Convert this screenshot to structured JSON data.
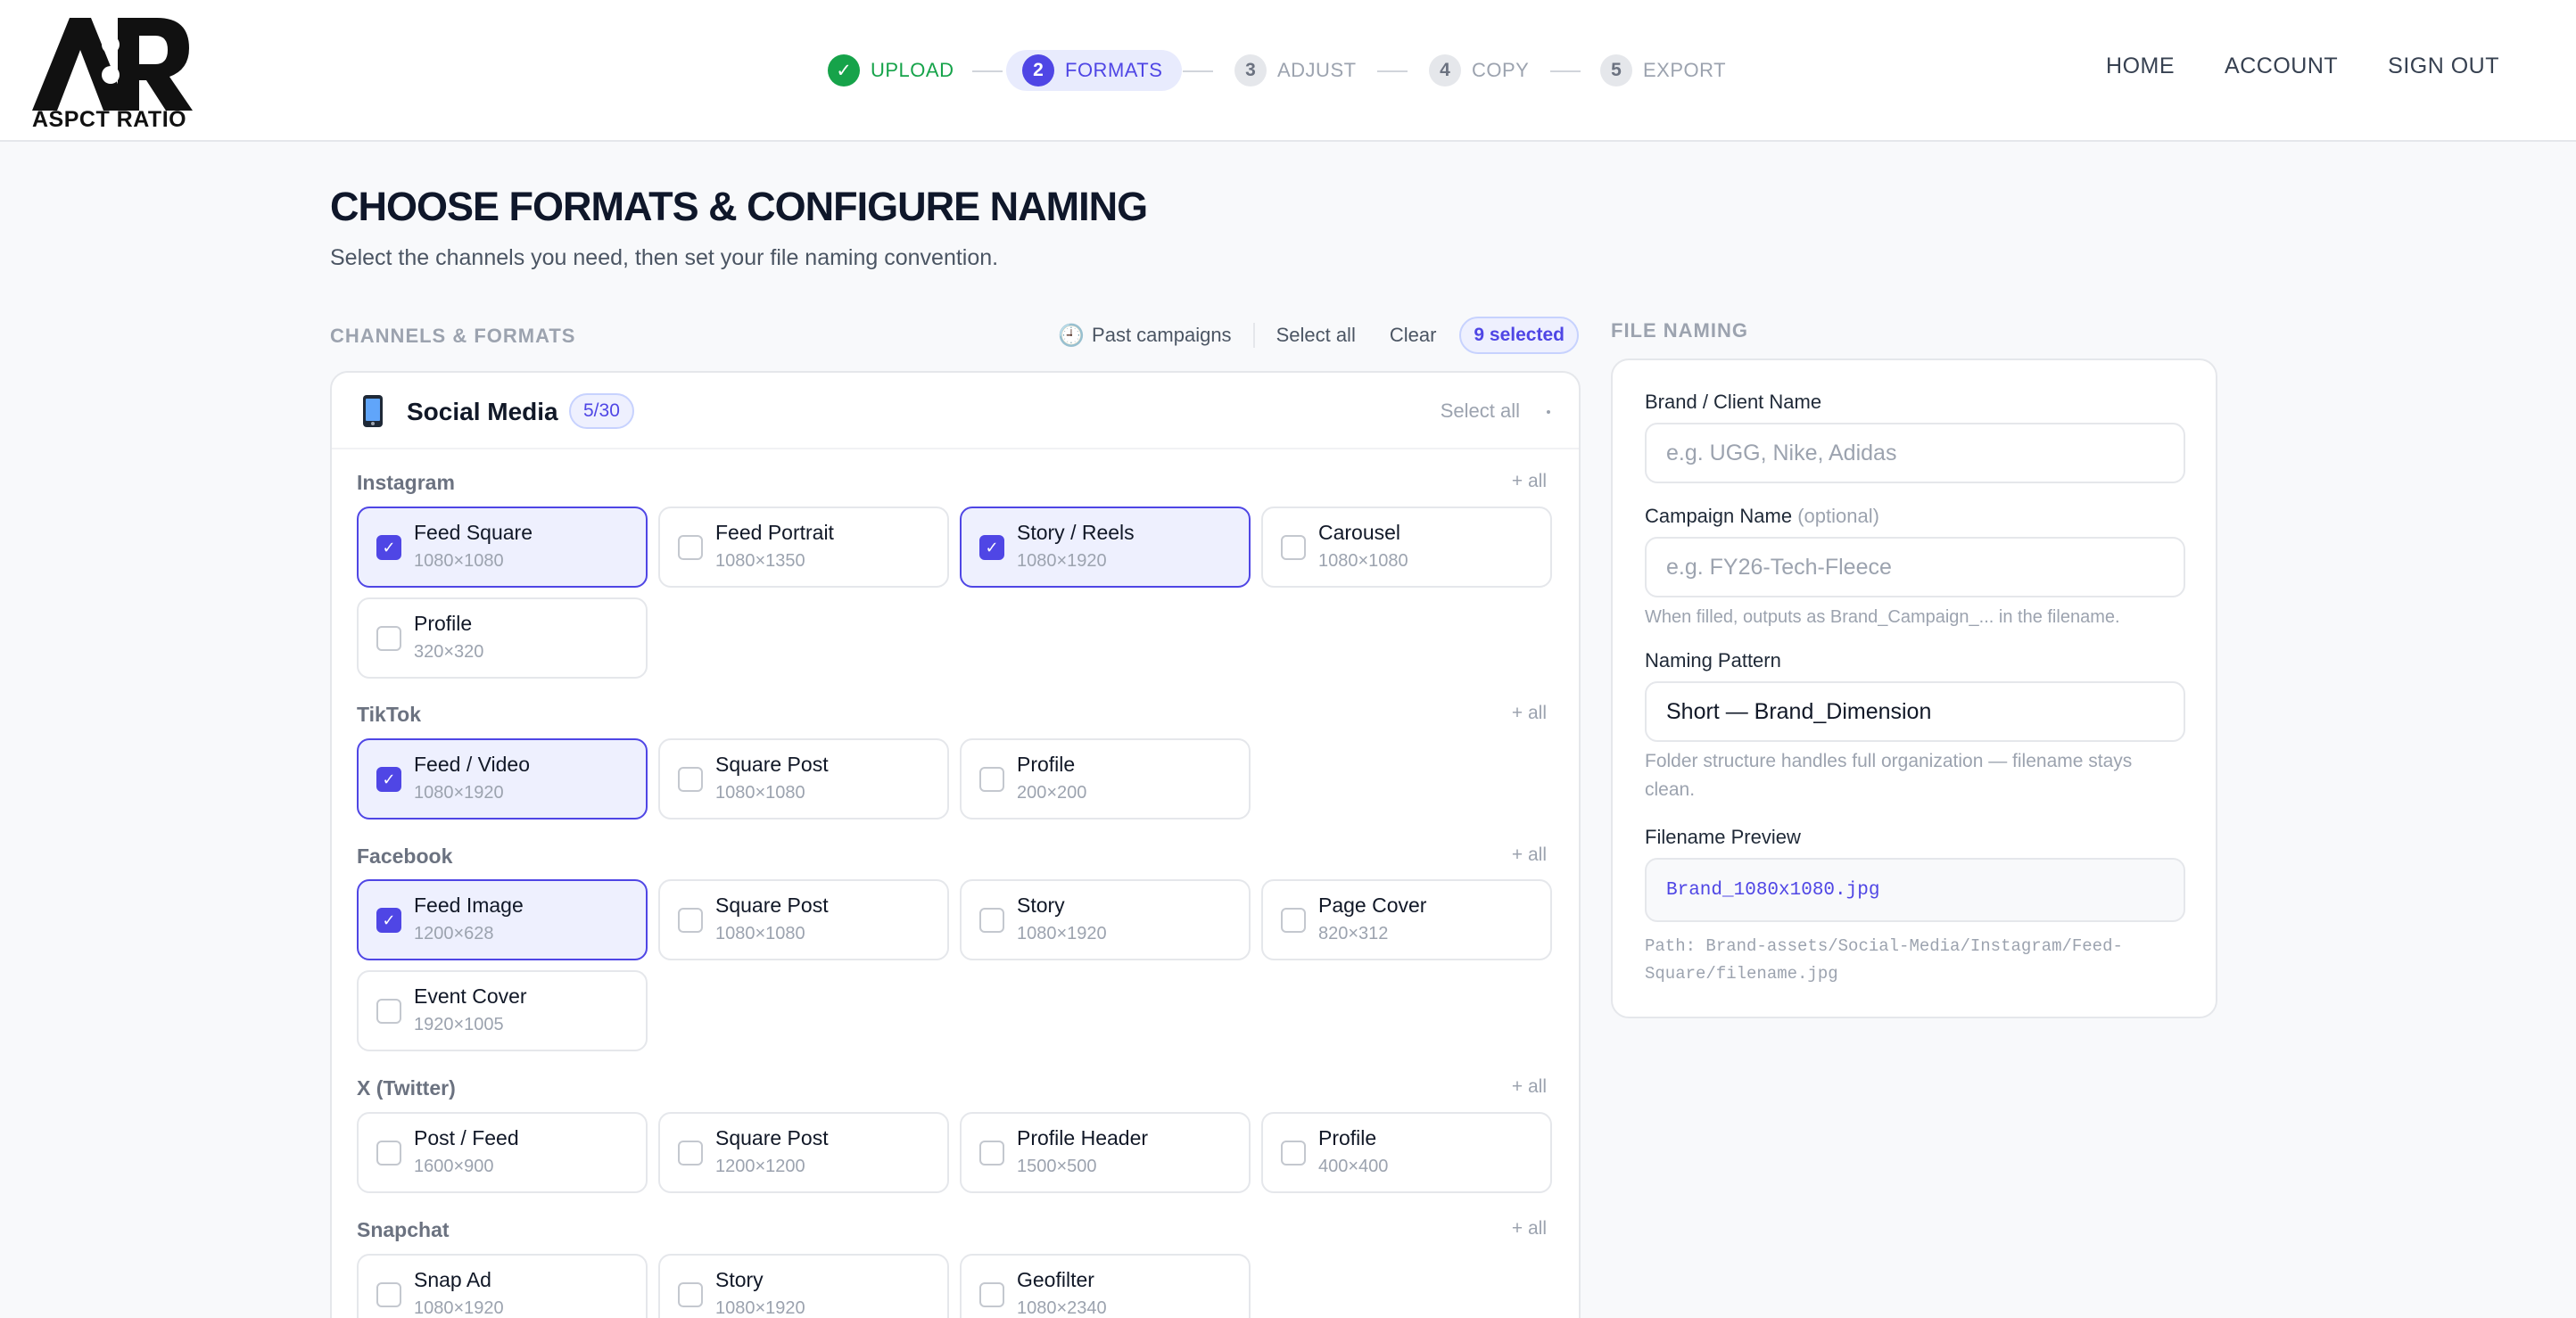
{
  "brand": {
    "logo_text": "ASPCT RATIO",
    "logo_mark_letters": "AR"
  },
  "stepper": [
    {
      "num": "1",
      "label": "UPLOAD",
      "state": "done"
    },
    {
      "num": "2",
      "label": "FORMATS",
      "state": "active"
    },
    {
      "num": "3",
      "label": "ADJUST",
      "state": "pending"
    },
    {
      "num": "4",
      "label": "COPY",
      "state": "pending"
    },
    {
      "num": "5",
      "label": "EXPORT",
      "state": "pending"
    }
  ],
  "nav": {
    "home": "HOME",
    "account": "ACCOUNT",
    "sign_out": "SIGN OUT"
  },
  "page": {
    "title": "CHOOSE FORMATS & CONFIGURE NAMING",
    "subtitle": "Select the channels you need, then set your file naming convention."
  },
  "channels": {
    "section_label": "CHANNELS & FORMATS",
    "toolbar": {
      "past_campaigns": "Past campaigns",
      "select_all": "Select all",
      "clear": "Clear",
      "selected_count": "9 selected"
    },
    "panel": {
      "title": "Social Media",
      "count": "5/30",
      "select_all": "Select all"
    },
    "groups": [
      {
        "name": "Instagram",
        "add_all": "+ all",
        "formats": [
          {
            "name": "Feed Square",
            "dims": "1080×1080",
            "checked": true
          },
          {
            "name": "Feed Portrait",
            "dims": "1080×1350",
            "checked": false
          },
          {
            "name": "Story / Reels",
            "dims": "1080×1920",
            "checked": true
          },
          {
            "name": "Carousel",
            "dims": "1080×1080",
            "checked": false
          },
          {
            "name": "Profile",
            "dims": "320×320",
            "checked": false
          }
        ]
      },
      {
        "name": "TikTok",
        "add_all": "+ all",
        "formats": [
          {
            "name": "Feed / Video",
            "dims": "1080×1920",
            "checked": true
          },
          {
            "name": "Square Post",
            "dims": "1080×1080",
            "checked": false
          },
          {
            "name": "Profile",
            "dims": "200×200",
            "checked": false
          }
        ]
      },
      {
        "name": "Facebook",
        "add_all": "+ all",
        "formats": [
          {
            "name": "Feed Image",
            "dims": "1200×628",
            "checked": true
          },
          {
            "name": "Square Post",
            "dims": "1080×1080",
            "checked": false
          },
          {
            "name": "Story",
            "dims": "1080×1920",
            "checked": false
          },
          {
            "name": "Page Cover",
            "dims": "820×312",
            "checked": false
          },
          {
            "name": "Event Cover",
            "dims": "1920×1005",
            "checked": false
          }
        ]
      },
      {
        "name": "X (Twitter)",
        "add_all": "+ all",
        "formats": [
          {
            "name": "Post / Feed",
            "dims": "1600×900",
            "checked": false
          },
          {
            "name": "Square Post",
            "dims": "1200×1200",
            "checked": false
          },
          {
            "name": "Profile Header",
            "dims": "1500×500",
            "checked": false
          },
          {
            "name": "Profile",
            "dims": "400×400",
            "checked": false
          }
        ]
      },
      {
        "name": "Snapchat",
        "add_all": "+ all",
        "formats": [
          {
            "name": "Snap Ad",
            "dims": "1080×1920",
            "checked": false
          },
          {
            "name": "Story",
            "dims": "1080×1920",
            "checked": false
          },
          {
            "name": "Geofilter",
            "dims": "1080×2340",
            "checked": false
          }
        ]
      }
    ]
  },
  "file_naming": {
    "section_label": "FILE NAMING",
    "brand_label": "Brand / Client Name",
    "brand_placeholder": "e.g. UGG, Nike, Adidas",
    "brand_value": "",
    "campaign_label": "Campaign Name",
    "campaign_optional": "(optional)",
    "campaign_placeholder": "e.g. FY26-Tech-Fleece",
    "campaign_value": "",
    "campaign_hint": "When filled, outputs as Brand_Campaign_... in the filename.",
    "pattern_label": "Naming Pattern",
    "pattern_value": "Short — Brand_Dimension",
    "pattern_hint": "Folder structure handles full organization — filename stays clean.",
    "preview_label": "Filename Preview",
    "preview_value": "Brand_1080x1080.jpg",
    "path_text": "Path: Brand-assets/Social-Media/Instagram/Feed-Square/filename.jpg"
  },
  "colors": {
    "accent": "#4f46e5",
    "accent_soft": "#eef0fe",
    "success": "#16a34a",
    "muted": "#9ca3af"
  }
}
